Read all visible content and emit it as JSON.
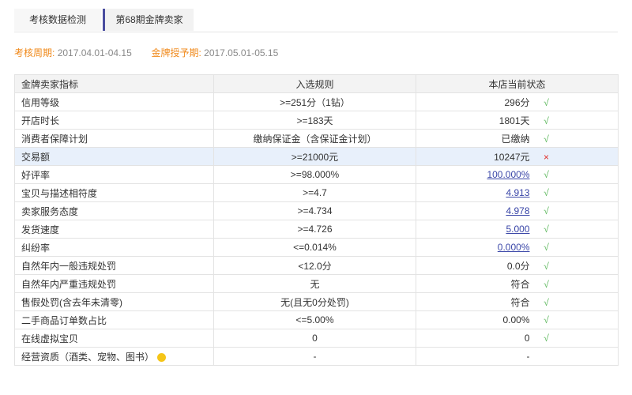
{
  "tabs": [
    {
      "label": "考核数据检测"
    },
    {
      "label": "第68期金牌卖家"
    }
  ],
  "period": {
    "assess_label": "考核周期:",
    "assess_value": "2017.04.01-04.15",
    "award_label": "金牌授予期:",
    "award_value": "2017.05.01-05.15"
  },
  "table": {
    "headers": [
      "金牌卖家指标",
      "入选规则",
      "本店当前状态"
    ],
    "rows": [
      {
        "metric": "信用等级",
        "rule": ">=251分（1钻）",
        "status": "296分",
        "link": false,
        "mark": "√"
      },
      {
        "metric": "开店时长",
        "rule": ">=183天",
        "status": "1801天",
        "link": false,
        "mark": "√"
      },
      {
        "metric": "消费者保障计划",
        "rule": "缴纳保证金（含保证金计划）",
        "status": "已缴纳",
        "link": false,
        "mark": "√"
      },
      {
        "metric": "交易额",
        "rule": ">=21000元",
        "status": "10247元",
        "link": false,
        "mark": "×"
      },
      {
        "metric": "好评率",
        "rule": ">=98.000%",
        "status": "100.000%",
        "link": true,
        "mark": "√"
      },
      {
        "metric": "宝贝与描述相符度",
        "rule": ">=4.7",
        "status": "4.913",
        "link": true,
        "mark": "√"
      },
      {
        "metric": "卖家服务态度",
        "rule": ">=4.734",
        "status": "4.978",
        "link": true,
        "mark": "√"
      },
      {
        "metric": "发货速度",
        "rule": ">=4.726",
        "status": "5.000",
        "link": true,
        "mark": "√"
      },
      {
        "metric": "纠纷率",
        "rule": "<=0.014%",
        "status": "0.000%",
        "link": true,
        "mark": "√"
      },
      {
        "metric": "自然年内一般违规处罚",
        "rule": "<12.0分",
        "status": "0.0分",
        "link": false,
        "mark": "√"
      },
      {
        "metric": "自然年内严重违规处罚",
        "rule": "无",
        "status": "符合",
        "link": false,
        "mark": "√"
      },
      {
        "metric": "售假处罚(含去年未清零)",
        "rule": "无(且无0分处罚)",
        "status": "符合",
        "link": false,
        "mark": "√"
      },
      {
        "metric": "二手商品订单数占比",
        "rule": "<=5.00%",
        "status": "0.00%",
        "link": false,
        "mark": "√"
      },
      {
        "metric": "在线虚拟宝贝",
        "rule": "0",
        "status": "0",
        "link": false,
        "mark": "√"
      },
      {
        "metric": "经营资质（酒类、宠物、图书）",
        "rule": "-",
        "status": "-",
        "link": false,
        "mark": ""
      }
    ]
  },
  "colors": {
    "accent_orange": "#f08a1c",
    "link_blue": "#3b47a8",
    "ok_green": "#5cb85c",
    "fail_red": "#e0302b",
    "highlight_row": "#e8f0fb"
  },
  "icons": {
    "pass": "check-icon",
    "fail": "cross-icon",
    "note": "smiley-icon"
  }
}
